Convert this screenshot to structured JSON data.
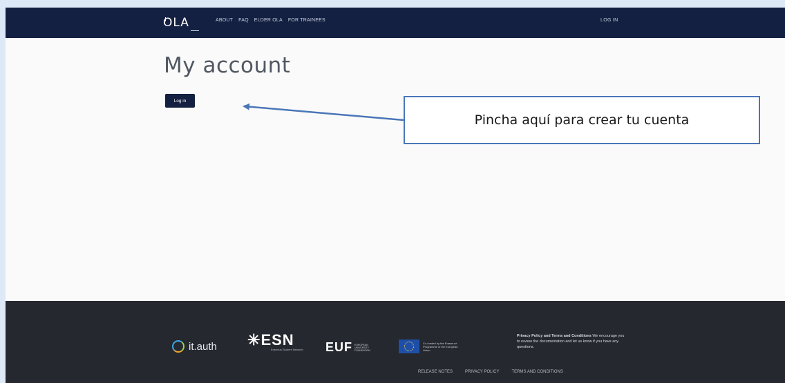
{
  "header": {
    "logo": "OLA",
    "nav": [
      "ABOUT",
      "FAQ",
      "ELDER OLA",
      "FOR TRAINEES"
    ],
    "login_link": "LOG IN"
  },
  "main": {
    "title": "My account",
    "login_button": "Log in"
  },
  "annotation": {
    "callout_text": "Pincha aquí para crear tu cuenta",
    "box_border_color": "#4a76b8",
    "arrow_color": "#4a76b8"
  },
  "footer": {
    "partners": {
      "itauth": "it.auth",
      "esn": "ESN",
      "esn_sub": "Erasmus Student Network",
      "euf": "EUF",
      "euf_sub": "EUROPEAN UNIVERSITY FOUNDATION",
      "eu_text": "Co-funded by the Erasmus+ Programme of the European Union"
    },
    "privacy_title": "Privacy Policy and Terms and Conditions",
    "privacy_body": "We encourage you to review the documentation and let us know if you have any questions.",
    "links": [
      "RELEASE NOTES",
      "PRIVACY POLICY",
      "TERMS AND CONDITIONS"
    ]
  },
  "colors": {
    "navbar": "#142041",
    "footer": "#25282e",
    "page_background": "#fafafa",
    "outer_background": "#dde9f7"
  }
}
